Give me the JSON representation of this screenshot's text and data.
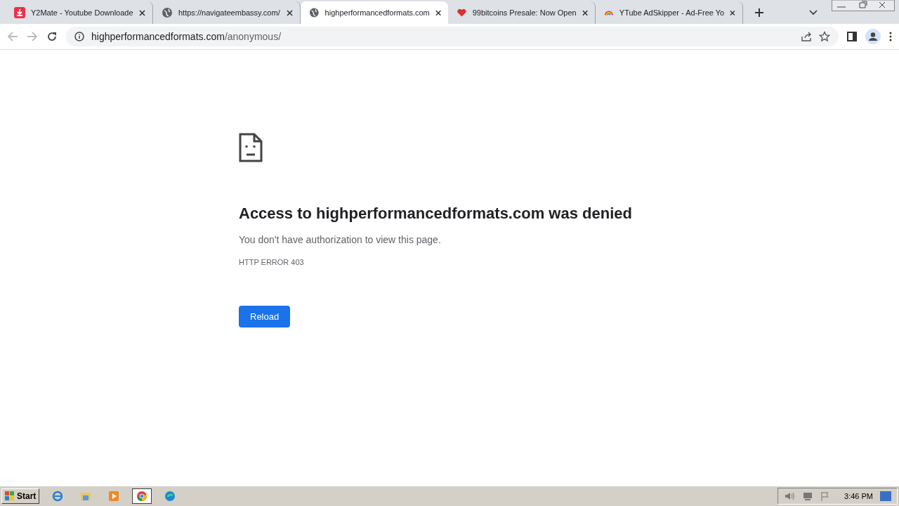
{
  "tabs": [
    {
      "title": "Y2Mate - Youtube Downloade",
      "kind": "download",
      "selected": false
    },
    {
      "title": "https://navigateembassy.com/",
      "kind": "globe",
      "selected": false
    },
    {
      "title": "highperformancedformats.com",
      "kind": "globe",
      "selected": true
    },
    {
      "title": "99bitcoins Presale: Now Open",
      "kind": "badge",
      "selected": false
    },
    {
      "title": "YTube AdSkipper - Ad-Free Yo",
      "kind": "rainbow",
      "selected": false
    }
  ],
  "address_bar": {
    "host": "highperformancedformats.com",
    "path": "/anonymous/"
  },
  "error_page": {
    "heading": "Access to highperformancedformats.com was denied",
    "message": "You don't have authorization to view this page.",
    "code": "HTTP ERROR 403",
    "button": "Reload"
  },
  "taskbar": {
    "start": "Start",
    "apps": [
      {
        "kind": "ie",
        "selected": false
      },
      {
        "kind": "folder",
        "selected": false
      },
      {
        "kind": "media",
        "selected": false
      },
      {
        "kind": "chrome",
        "selected": true
      },
      {
        "kind": "edge",
        "selected": false
      }
    ],
    "clock": "3:46 PM"
  }
}
